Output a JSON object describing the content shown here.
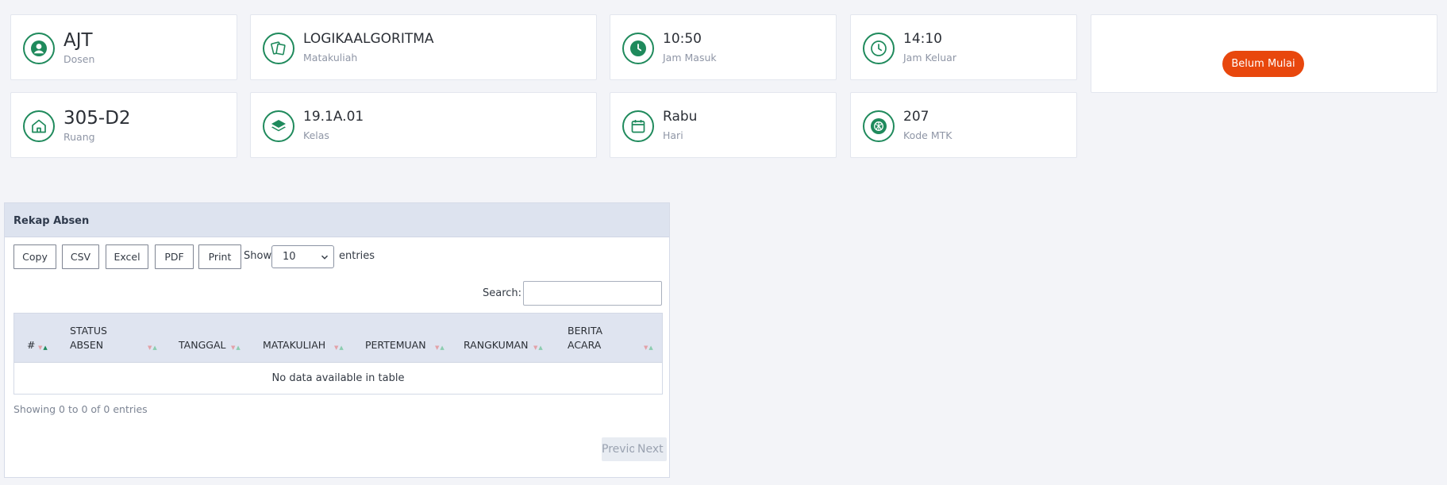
{
  "info_cards": {
    "dosen": {
      "value": "AJT",
      "label": "Dosen",
      "icon": "user-circle-icon"
    },
    "matakuliah": {
      "value": "LOGIKAALGORITMA",
      "label": "Matakuliah",
      "icon": "documents-icon"
    },
    "jam_masuk": {
      "value": "10:50",
      "label": "Jam Masuk",
      "icon": "clock-filled-icon"
    },
    "jam_keluar": {
      "value": "14:10",
      "label": "Jam Keluar",
      "icon": "clock-outline-icon"
    },
    "ruang": {
      "value": "305-D2",
      "label": "Ruang",
      "icon": "home-icon"
    },
    "kelas": {
      "value": "19.1A.01",
      "label": "Kelas",
      "icon": "layers-icon"
    },
    "hari": {
      "value": "Rabu",
      "label": "Hari",
      "icon": "calendar-icon"
    },
    "kode_mtk": {
      "value": "207",
      "label": "Kode MTK",
      "icon": "ball-icon"
    }
  },
  "status_badge": {
    "label": "Belum Mulai",
    "color": "#e8470d"
  },
  "accent_color": "#1f8a5c",
  "rekap": {
    "title": "Rekap Absen",
    "buttons": {
      "copy": "Copy",
      "csv": "CSV",
      "excel": "Excel",
      "pdf": "PDF",
      "print": "Print"
    },
    "show_label": "Show",
    "page_length": "10",
    "entries_label": "entries",
    "search_label": "Search:",
    "search_value": "",
    "columns": {
      "no": "#",
      "status_line1": "STATUS",
      "status_line2": "ABSEN",
      "tanggal": "TANGGAL",
      "matakuliah": "MATAKULIAH",
      "pertemuan": "PERTEMUAN",
      "rangkuman": "RANGKUMAN",
      "berita_line1": "BERITA",
      "berita_line2": "ACARA"
    },
    "sort_glyph_down": "▼",
    "sort_glyph_up": "▲",
    "empty_message": "No data available in table",
    "info": "Showing 0 to 0 of 0 entries",
    "pager": {
      "previous": "Previous",
      "next": "Next"
    }
  }
}
